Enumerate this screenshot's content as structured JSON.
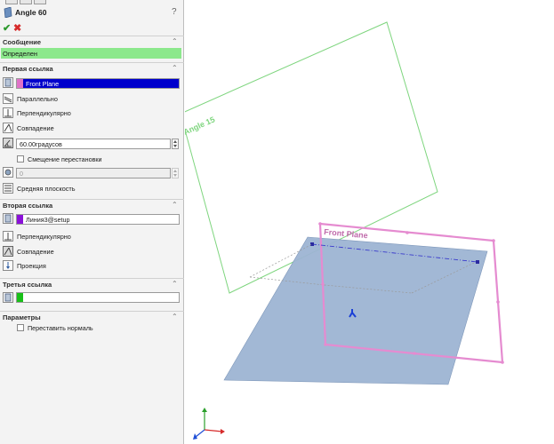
{
  "feature": {
    "title": "Angle 60",
    "help_icon": "?",
    "ok_icon": "checkmark-icon",
    "cancel_icon": "close-icon"
  },
  "message": {
    "header": "Сообщение",
    "status": "Определен",
    "status_color": "#8ce88c"
  },
  "first_ref": {
    "header": "Первая ссылка",
    "value": "Front Plane",
    "value_color": "#0000cc",
    "swatch_color": "#e072c8",
    "options": [
      "Параллельно",
      "Перпендикулярно",
      "Совпадение"
    ],
    "angle": "60.00градусов",
    "flip_label": "Смещение перестановки",
    "flip_checked": false,
    "distance": "0",
    "mid_plane_label": "Средняя плоскость"
  },
  "second_ref": {
    "header": "Вторая ссылка",
    "value": "Линия3@setup",
    "swatch_color": "#8a10d8",
    "options": [
      "Перпендикулярно",
      "Совпадение",
      "Проекция"
    ]
  },
  "third_ref": {
    "header": "Третья ссылка",
    "value": "",
    "swatch_color": "#18c018"
  },
  "params": {
    "header": "Параметры",
    "reverse_normal_label": "Переставить нормаль",
    "reverse_normal_checked": false
  },
  "viewport": {
    "plane_angle_label": "Angle 15",
    "plane_front_label": "Front Plane",
    "angle_plane_color": "#7ed57e",
    "front_plane_color": "#e58bd0",
    "shaded_plane_color": "#9db4d3"
  }
}
